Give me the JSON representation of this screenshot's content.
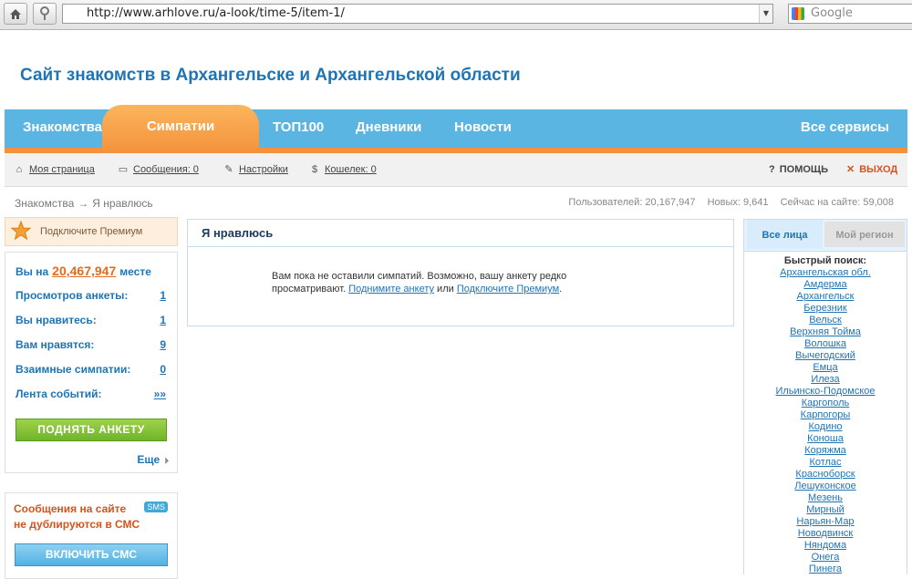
{
  "browser": {
    "url": "http://www.arhlove.ru/a-look/time-5/item-1/",
    "search_placeholder": "Google"
  },
  "site": {
    "title": "Сайт знакомств в Архангельске и Архангельской области"
  },
  "nav": {
    "items": [
      "Знакомства",
      "Симпатии",
      "ТОП100",
      "Дневники",
      "Новости"
    ],
    "active": "Симпатии",
    "right": "Все сервисы"
  },
  "subnav": {
    "my_page": "Моя страница",
    "messages": "Сообщения: 0",
    "settings": "Настройки",
    "wallet": "Кошелек: 0",
    "help": "ПОМОЩЬ",
    "exit": "ВЫХОД"
  },
  "breadcrumb": {
    "root": "Знакомства",
    "arrow": "→",
    "current": "Я нравлюсь"
  },
  "stats": {
    "users": "Пользователей: 20,167,947",
    "new": "Новых: 9,641",
    "online": "Сейчас на сайте: 59,008"
  },
  "premium": {
    "label": "Подключите Премиум"
  },
  "profile_stats": {
    "rank_prefix": "Вы на",
    "rank_value": "20,467,947",
    "rank_suffix": "месте",
    "views_label": "Просмотров анкеты:",
    "views_value": "1",
    "liked_label": "Вы нравитесь:",
    "liked_value": "1",
    "likes_label": "Вам нравятся:",
    "likes_value": "9",
    "mutual_label": "Взаимные симпатии:",
    "mutual_value": "0",
    "feed_label": "Лента событий:",
    "feed_value": "»»",
    "raise_button": "ПОДНЯТЬ АНКЕТУ",
    "more_label": "Еще"
  },
  "sms": {
    "text": "Сообщения на сайте не дублируются в СМС",
    "badge": "SMS",
    "button": "ВКЛЮЧИТЬ СМС"
  },
  "center": {
    "title": "Я нравлюсь",
    "message_part1": "Вам пока не оставили симпатий. Возможно, вашу анкету редко просматривают.",
    "link1": "Поднимите анкету",
    "or": "или",
    "link2": "Подключите Премиум",
    "end": "."
  },
  "right_panel": {
    "tab_all": "Все лица",
    "tab_region": "Мой регион",
    "quick_search": "Быстрый поиск:",
    "cities": [
      "Архангельская обл.",
      "Амдерма",
      "Архангельск",
      "Березник",
      "Вельск",
      "Верхняя Тойма",
      "Волошка",
      "Вычегодский",
      "Емца",
      "Илеза",
      "Ильинско-Подомское",
      "Каргополь",
      "Карпогоры",
      "Кодино",
      "Коноша",
      "Коряжма",
      "Котлас",
      "Красноборск",
      "Лешуконское",
      "Мезень",
      "Мирный",
      "Нарьян-Мар",
      "Новодвинск",
      "Няндома",
      "Онега",
      "Пинега"
    ]
  }
}
